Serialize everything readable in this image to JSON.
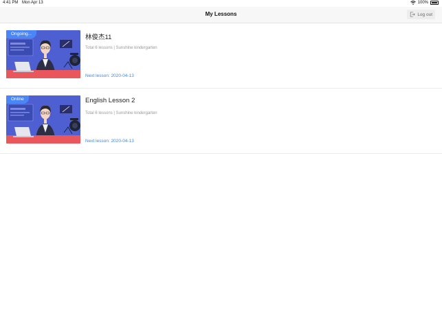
{
  "status": {
    "time": "4:41 PM",
    "date": "Mon Apr 13",
    "battery": "100%"
  },
  "nav": {
    "title": "My Lessons",
    "logout_label": "Log out"
  },
  "lessons": [
    {
      "tag": "Ongoing...",
      "title": "林俊杰11",
      "subtitle": "Total 6 lessons | Sunshine kindergarten",
      "next": "Next lesson: 2020-04-13"
    },
    {
      "tag": "Online",
      "title": "English Lesson 2",
      "subtitle": "Total 6 lessons | Sunshine kindergarten",
      "next": "Next lesson: 2020-04-13"
    }
  ],
  "colors": {
    "accent": "#3d86e8",
    "tag_bg": "#4a86f7",
    "thumb_bg": "#4d5fd1",
    "desk": "#e9575c"
  }
}
